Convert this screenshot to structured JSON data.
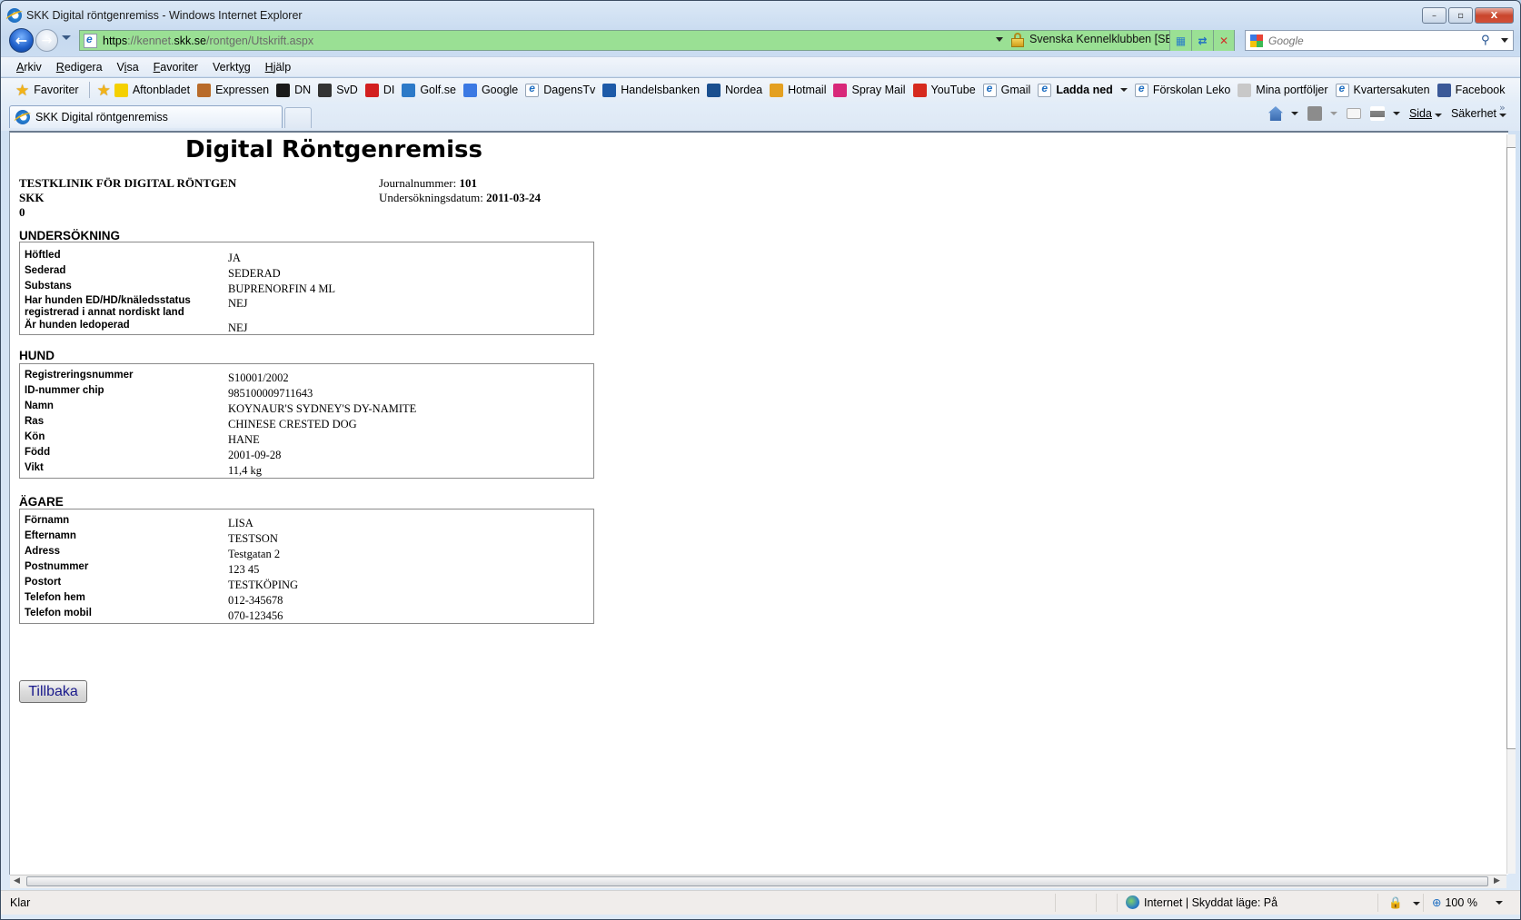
{
  "window": {
    "title": "SKK Digital röntgenremiss - Windows Internet Explorer",
    "buttons": {
      "minimize": "–",
      "maximize": "▫",
      "close": "X"
    }
  },
  "nav": {
    "url_proto": "https",
    "url_sep": "://kennet.",
    "url_domain": "skk.se",
    "url_path": "/rontgen/Utskrift.aspx",
    "certificate_label": "Svenska Kennelklubben [SE]",
    "search_placeholder": "Google"
  },
  "menu": {
    "items": [
      {
        "label": "Arkiv",
        "accel": "A",
        "rest": "rkiv"
      },
      {
        "label": "Redigera",
        "accel": "R",
        "rest": "edigera"
      },
      {
        "label": "Visa",
        "pre": "V",
        "accel": "i",
        "rest": "sa"
      },
      {
        "label": "Favoriter",
        "accel": "F",
        "rest": "avoriter"
      },
      {
        "label": "Verktyg",
        "pre": "Verkt",
        "accel": "y",
        "rest": "g"
      },
      {
        "label": "Hjälp",
        "accel": "H",
        "rest": "jälp"
      }
    ]
  },
  "favorites": {
    "favorites_label": "Favoriter",
    "items": [
      {
        "label": "Aftonbladet",
        "icon": "aftonbladet-icon",
        "color": "#f4d000"
      },
      {
        "label": "Expressen",
        "icon": "expressen-icon",
        "color": "#b86b2a"
      },
      {
        "label": "DN",
        "icon": "dn-icon",
        "color": "#1a1a1a"
      },
      {
        "label": "SvD",
        "icon": "svd-icon",
        "color": "#333333"
      },
      {
        "label": "DI",
        "icon": "di-icon",
        "color": "#d21f1f"
      },
      {
        "label": "Golf.se",
        "icon": "golf-icon",
        "color": "#2d7ac8"
      },
      {
        "label": "Google",
        "icon": "google-icon",
        "color": "#3b79e3"
      },
      {
        "label": "DagensTv",
        "icon": "ie-page-icon",
        "color": "#1f6fc2"
      },
      {
        "label": "Handelsbanken",
        "icon": "shb-icon",
        "color": "#1d5aa8"
      },
      {
        "label": "Nordea",
        "icon": "nordea-icon",
        "color": "#1a4f8f"
      },
      {
        "label": "Hotmail",
        "icon": "windows-icon",
        "color": "#e4a021"
      },
      {
        "label": "Spray Mail",
        "icon": "spray-icon",
        "color": "#d8287a"
      },
      {
        "label": "YouTube",
        "icon": "youtube-icon",
        "color": "#d62a1e"
      },
      {
        "label": "Gmail",
        "icon": "ie-page-icon",
        "color": "#1f6fc2"
      },
      {
        "label": "Ladda ned",
        "icon": "ie-page-icon",
        "color": "#1f6fc2",
        "bold": true,
        "dropdown": true
      },
      {
        "label": "Förskolan Leko",
        "icon": "ie-page-icon",
        "color": "#1f6fc2"
      },
      {
        "label": "Mina portföljer",
        "icon": "grid-icon",
        "color": "#c8c8c8"
      },
      {
        "label": "Kvartersakuten",
        "icon": "ie-page-icon",
        "color": "#1f6fc2"
      },
      {
        "label": "Facebook",
        "icon": "facebook-icon",
        "color": "#3b5998"
      }
    ]
  },
  "tab": {
    "title": "SKK Digital röntgenremiss"
  },
  "commandbar": {
    "page_label": "Sida",
    "safety_label": "Säkerhet",
    "more": "»"
  },
  "page": {
    "title": "Digital Röntgenremiss",
    "clinic_lines": [
      "TESTKLINIK FÖR DIGITAL RÖNTGEN",
      "SKK",
      "0"
    ],
    "journal_label": "Journalnummer: ",
    "journal_value": "101",
    "date_label": "Undersökningsdatum: ",
    "date_value": "2011-03-24",
    "sections": [
      {
        "heading": "UNDERSÖKNING",
        "rows": [
          {
            "label": "Höftled",
            "value": "JA"
          },
          {
            "label": "Sederad",
            "value": "SEDERAD"
          },
          {
            "label": "Substans",
            "value": "BUPRENORFIN 4 ML"
          },
          {
            "label": "Har hunden ED/HD/knäledsstatus registrerad i annat nordiskt land",
            "value": "NEJ"
          },
          {
            "label": "Är hunden ledoperad",
            "value": "NEJ"
          }
        ]
      },
      {
        "heading": "HUND",
        "rows": [
          {
            "label": "Registreringsnummer",
            "value": "S10001/2002"
          },
          {
            "label": "ID-nummer chip",
            "value": "985100009711643"
          },
          {
            "label": "Namn",
            "value": "KOYNAUR'S SYDNEY'S DY-NAMITE"
          },
          {
            "label": "Ras",
            "value": "CHINESE CRESTED DOG"
          },
          {
            "label": "Kön",
            "value": "HANE"
          },
          {
            "label": "Född",
            "value": "2001-09-28"
          },
          {
            "label": "Vikt",
            "value": "11,4 kg"
          }
        ]
      },
      {
        "heading": "ÄGARE",
        "rows": [
          {
            "label": "Förnamn",
            "value": "LISA"
          },
          {
            "label": "Efternamn",
            "value": "TESTSON"
          },
          {
            "label": "Adress",
            "value": "Testgatan 2"
          },
          {
            "label": "Postnummer",
            "value": "123 45"
          },
          {
            "label": "Postort",
            "value": "TESTKÖPING"
          },
          {
            "label": "Telefon hem",
            "value": "012-345678"
          },
          {
            "label": "Telefon mobil",
            "value": "070-123456"
          }
        ]
      }
    ],
    "back_button": "Tillbaka"
  },
  "status": {
    "text": "Klar",
    "zone": "Internet | Skyddat läge: På",
    "zoom": "100 %"
  }
}
